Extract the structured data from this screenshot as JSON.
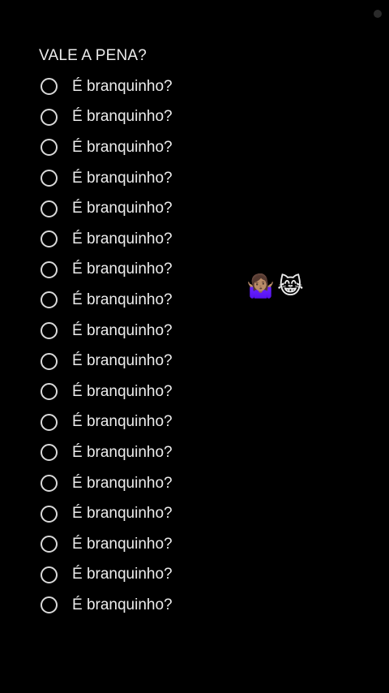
{
  "note": {
    "title": "VALE A PENA?",
    "items": [
      {
        "label": "É branquinho?",
        "checked": false
      },
      {
        "label": "É branquinho?",
        "checked": false
      },
      {
        "label": "É branquinho?",
        "checked": false
      },
      {
        "label": "É branquinho?",
        "checked": false
      },
      {
        "label": "É branquinho?",
        "checked": false
      },
      {
        "label": "É branquinho?",
        "checked": false
      },
      {
        "label": "É branquinho?",
        "checked": false
      },
      {
        "label": "É branquinho?",
        "checked": false
      },
      {
        "label": "É branquinho?",
        "checked": false
      },
      {
        "label": "É branquinho?",
        "checked": false
      },
      {
        "label": "É branquinho?",
        "checked": false
      },
      {
        "label": "É branquinho?",
        "checked": false
      },
      {
        "label": "É branquinho?",
        "checked": false
      },
      {
        "label": "É branquinho?",
        "checked": false
      },
      {
        "label": "É branquinho?",
        "checked": false
      },
      {
        "label": "É branquinho?",
        "checked": false
      },
      {
        "label": "É branquinho?",
        "checked": false
      },
      {
        "label": "É branquinho?",
        "checked": false
      }
    ]
  },
  "stickers": {
    "shrug": "🤷🏽‍♀️",
    "cat": "😹"
  },
  "colors": {
    "background": "#000000",
    "text": "#ececec",
    "circle": "#d9d9d9"
  }
}
